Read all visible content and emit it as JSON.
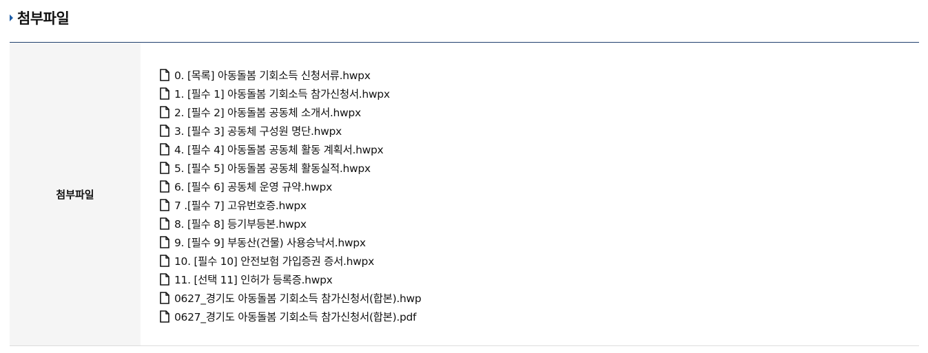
{
  "section": {
    "title": "첨부파일"
  },
  "attachments": {
    "label": "첨부파일",
    "files": [
      "0. [목록] 아동돌봄 기회소득 신청서류.hwpx",
      "1. [필수 1] 아동돌봄 기회소득 참가신청서.hwpx",
      "2. [필수 2] 아동돌봄 공동체 소개서.hwpx",
      "3. [필수 3] 공동체 구성원 명단.hwpx",
      "4. [필수 4] 아동돌봄 공동체 활동 계획서.hwpx",
      "5. [필수 5] 아동돌봄 공동체 활동실적.hwpx",
      "6. [필수 6] 공동체 운영 규약.hwpx",
      "7 .[필수 7] 고유번호증.hwpx",
      "8. [필수 8] 등기부등본.hwpx",
      "9. [필수 9] 부동산(건물) 사용승낙서.hwpx",
      "10. [필수 10] 안전보험 가입증권 증서.hwpx",
      "11. [선택 11] 인허가 등록증.hwpx",
      "0627_경기도 아동돌봄 기회소득 참가신청서(합본).hwp",
      "0627_경기도 아동돌봄 기회소득 참가신청서(합본).pdf"
    ],
    "file_icon": "document-icon"
  },
  "colors": {
    "accent": "#1f5ea8",
    "table_top_border": "#1d3d6b",
    "header_cell_bg": "#f5f5f5"
  }
}
